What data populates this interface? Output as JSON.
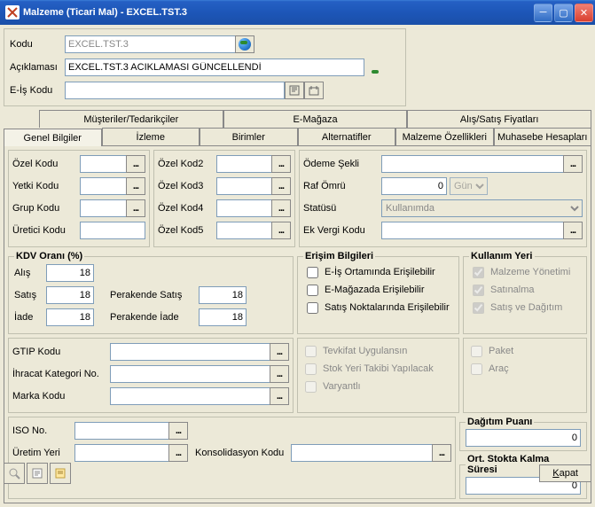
{
  "window": {
    "title": "Malzeme (Ticari Mal) - EXCEL.TST.3"
  },
  "header": {
    "kodu_label": "Kodu",
    "kodu": "EXCEL.TST.3",
    "acik_label": "Açıklaması",
    "acik": "EXCEL.TST.3 ACIKLAMASI GÜNCELLENDİ",
    "eis_label": "E-İş Kodu",
    "eis": ""
  },
  "tabs_back": {
    "t1": "Müşteriler/Tedarikçiler",
    "t2": "E-Mağaza",
    "t3": "Alış/Satış Fiyatları"
  },
  "tabs_front": {
    "t1": "Genel Bilgiler",
    "t2": "İzleme",
    "t3": "Birimler",
    "t4": "Alternatifler",
    "t5": "Malzeme Özellikleri",
    "t6": "Muhasebe Hesapları"
  },
  "colA": {
    "ozel": "Özel Kodu",
    "yetki": "Yetki Kodu",
    "grup": "Grup Kodu",
    "uretici": "Üretici Kodu"
  },
  "colB": {
    "k2": "Özel Kod2",
    "k3": "Özel Kod3",
    "k4": "Özel Kod4",
    "k5": "Özel Kod5"
  },
  "colC": {
    "odeme": "Ödeme Şekli",
    "raf": "Raf Ömrü",
    "raf_v": "0",
    "raf_unit": "Gün",
    "statu": "Statüsü",
    "statu_v": "Kullanımda",
    "ekvergi": "Ek Vergi Kodu"
  },
  "kdv": {
    "legend": "KDV Oranı (%)",
    "alis": "Alış",
    "alis_v": "18",
    "satis": "Satış",
    "satis_v": "18",
    "iade": "İade",
    "iade_v": "18",
    "per_satis": "Perakende Satış",
    "per_satis_v": "18",
    "per_iade": "Perakende İade",
    "per_iade_v": "18"
  },
  "erisim": {
    "legend": "Erişim Bilgileri",
    "c1": "E-İş Ortamında Erişilebilir",
    "c2": "E-Mağazada Erişilebilir",
    "c3": "Satış Noktalarında Erişilebilir"
  },
  "kullanim": {
    "legend": "Kullanım Yeri",
    "c1": "Malzeme Yönetimi",
    "c2": "Satınalma",
    "c3": "Satış ve Dağıtım"
  },
  "mid": {
    "gtip": "GTIP Kodu",
    "ihracat": "İhracat Kategori No.",
    "marka": "Marka Kodu",
    "tevkifat": "Tevkifat Uygulansın",
    "stok": "Stok Yeri Takibi Yapılacak",
    "varyant": "Varyantlı",
    "paket": "Paket",
    "arac": "Araç"
  },
  "bot": {
    "iso": "ISO No.",
    "uretim": "Üretim Yeri",
    "konsol": "Konsolidasyon Kodu",
    "dagitim_legend": "Dağıtım Puanı",
    "dagitim_v": "0",
    "ort_legend": "Ort. Stokta Kalma Süresi",
    "ort_v": "0"
  },
  "footer": {
    "close": "Kapat"
  }
}
